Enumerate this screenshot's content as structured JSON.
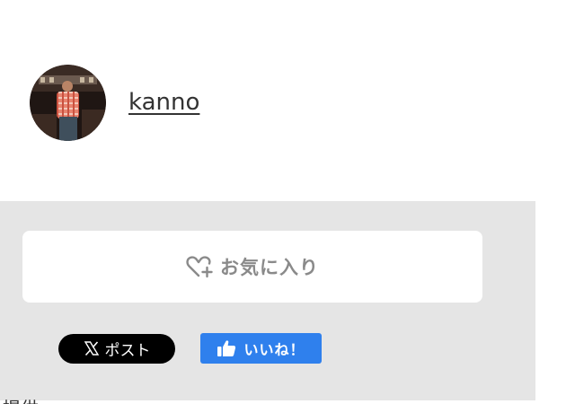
{
  "author": {
    "name": "kanno",
    "avatar_icon": "avatar-photo"
  },
  "actions": {
    "favorite_label": "お気に入り",
    "favorite_icon": "heart-plus-icon",
    "x_post_label": "ポスト",
    "x_icon": "x-logo-icon",
    "like_label": "いいね！",
    "like_icon": "thumbs-up-icon"
  },
  "footer": {
    "partial_text": "提供 　 　 　"
  },
  "colors": {
    "panel_background": "#e5e5e5",
    "like_blue": "#2f80ed",
    "x_black": "#000000",
    "muted_gray": "#8a8a8a"
  }
}
